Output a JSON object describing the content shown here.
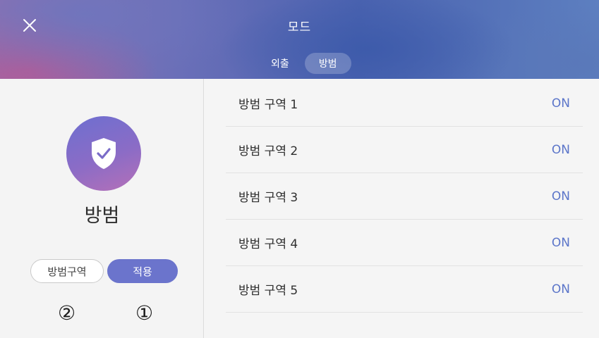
{
  "header": {
    "close_icon": "close-icon",
    "title": "모드",
    "tabs": [
      {
        "label": "외출",
        "active": false
      },
      {
        "label": "방범",
        "active": true
      }
    ]
  },
  "mode": {
    "icon": "shield-check-icon",
    "name": "방범",
    "zone_button": "방범구역",
    "apply_button": "적용",
    "markers": [
      "②",
      "①"
    ]
  },
  "zones": [
    {
      "label": "방범 구역 1",
      "status": "ON"
    },
    {
      "label": "방범 구역 2",
      "status": "ON"
    },
    {
      "label": "방범 구역 3",
      "status": "ON"
    },
    {
      "label": "방범 구역 4",
      "status": "ON"
    },
    {
      "label": "방범 구역 5",
      "status": "ON"
    }
  ],
  "colors": {
    "accent": "#6b74cc",
    "status_on": "#5b75c9"
  }
}
